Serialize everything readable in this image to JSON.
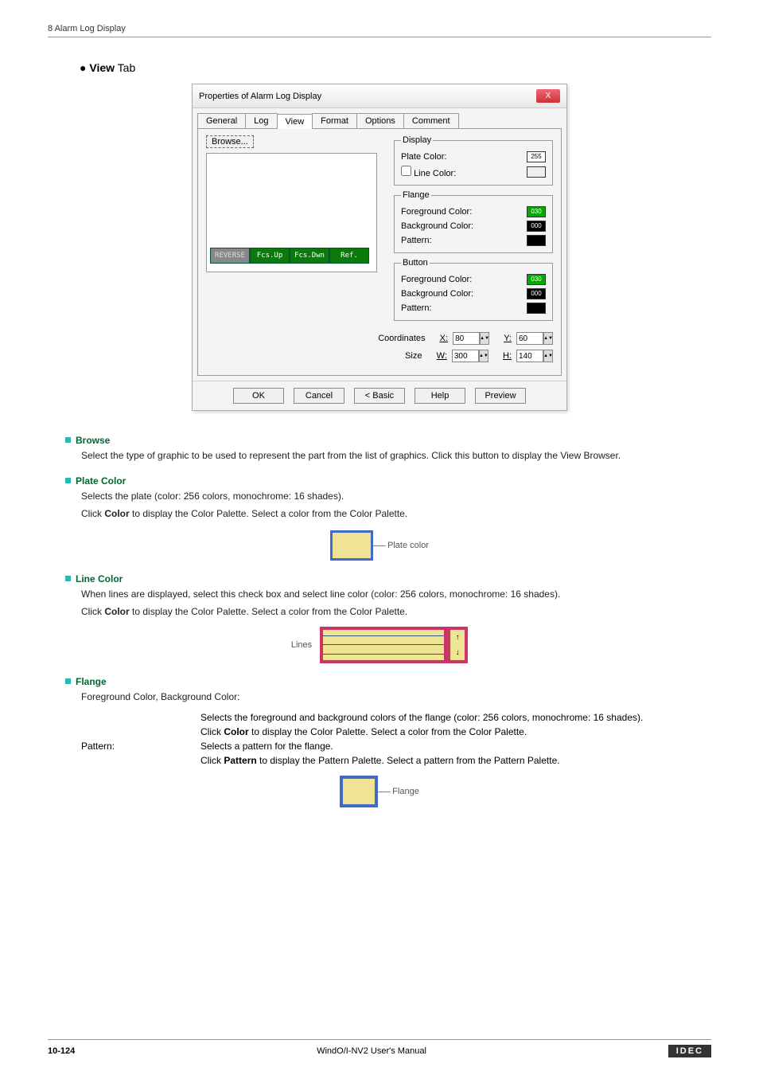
{
  "breadcrumb": "8 Alarm Log Display",
  "section": {
    "bullet": "●",
    "bold": "View",
    "rest": " Tab"
  },
  "dialog": {
    "title": "Properties of Alarm Log Display",
    "close": "X",
    "tabs": {
      "general": "General",
      "log": "Log",
      "view": "View",
      "format": "Format",
      "options": "Options",
      "comment": "Comment"
    },
    "browse": "Browse...",
    "toolbar": {
      "reverse": "REVERSE",
      "fcsup": "Fcs.Up",
      "fcsdwn": "Fcs.Dwn",
      "ref": "Ref."
    },
    "groups": {
      "display": {
        "legend": "Display",
        "plate_label": "Plate Color:",
        "plate_val": "255",
        "line_label": "Line Color:"
      },
      "flange": {
        "legend": "Flange",
        "fg_label": "Foreground Color:",
        "fg_val": "030",
        "bg_label": "Background Color:",
        "bg_val": "000",
        "pattern_label": "Pattern:"
      },
      "button": {
        "legend": "Button",
        "fg_label": "Foreground Color:",
        "fg_val": "030",
        "bg_label": "Background Color:",
        "bg_val": "000",
        "pattern_label": "Pattern:"
      }
    },
    "coords": {
      "coord_label": "Coordinates",
      "size_label": "Size",
      "x": "X:",
      "xv": "80",
      "y": "Y:",
      "yv": "60",
      "w": "W:",
      "wv": "300",
      "h": "H:",
      "hv": "140"
    },
    "buttons": {
      "ok": "OK",
      "cancel": "Cancel",
      "basic": "< Basic",
      "help": "Help",
      "preview": "Preview"
    }
  },
  "browse": {
    "title": "Browse",
    "text": "Select the type of graphic to be used to represent the part from the list of graphics. Click this button to display the View Browser."
  },
  "plate": {
    "title": "Plate Color",
    "p1": "Selects the plate (color: 256 colors, monochrome: 16 shades).",
    "p2a": "Click ",
    "p2b": "Color",
    "p2c": " to display the Color Palette. Select a color from the Color Palette.",
    "callout": "Plate color"
  },
  "line": {
    "title": "Line Color",
    "p1": "When lines are displayed, select this check box and select line color (color: 256 colors, monochrome: 16 shades).",
    "p2a": "Click ",
    "p2b": "Color",
    "p2c": " to display the Color Palette. Select a color from the Color Palette.",
    "callout": "Lines"
  },
  "flange": {
    "title": "Flange",
    "sub": "Foreground Color, Background Color:",
    "d1": "Selects the foreground and background colors of the flange (color: 256 colors, monochrome: 16 shades).",
    "d2a": "Click ",
    "d2b": "Color",
    "d2c": " to display the Color Palette. Select a color from the Color Palette.",
    "pattern_lbl": "Pattern:",
    "p1": "Selects a pattern for the flange.",
    "p2a": "Click ",
    "p2b": "Pattern",
    "p2c": " to display the Pattern Palette. Select a pattern from the Pattern Palette.",
    "callout": "Flange"
  },
  "footer": {
    "page": "10-124",
    "manual": "WindO/I-NV2 User's Manual",
    "brand": "IDEC"
  }
}
